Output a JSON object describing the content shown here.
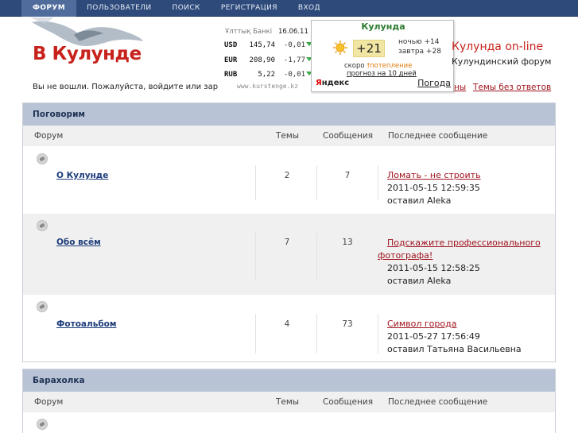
{
  "nav": {
    "items": [
      "ФОРУМ",
      "ПОЛЬЗОВАТЕЛИ",
      "ПОИСК",
      "РЕГИСТРАЦИЯ",
      "ВХОД"
    ],
    "active": 0
  },
  "logo": {
    "text": "В Кулунде"
  },
  "currency": {
    "title": "Ұлттық Банкі",
    "date": "16.06.11",
    "rows": [
      {
        "code": "USD",
        "value": "145,74",
        "change": "-0,01"
      },
      {
        "code": "EUR",
        "value": "208,90",
        "change": "-1,77"
      },
      {
        "code": "RUB",
        "value": "5,22",
        "change": "-0,01"
      }
    ],
    "source": "www.kurstenge.kz"
  },
  "weather": {
    "city": "Кулунда",
    "temp": "+21",
    "night": "ночью +14",
    "tomorrow": "завтра +28",
    "soon_prefix": "скоро",
    "soon_text": "потепление",
    "forecast_link": "прогноз на 10 дней",
    "provider_y": "Я",
    "provider_rest": "ндекс",
    "pogoda": "Погода"
  },
  "site": {
    "title": "Кулунда on-line",
    "description": "Кулундинский форум"
  },
  "login_message": "Вы не вошли. Пожалуйста, войдите или заре",
  "top_links": {
    "a": "ны",
    "b": "Темы без ответов"
  },
  "columns": {
    "forum": "Форум",
    "topics": "Темы",
    "posts": "Сообщения",
    "last": "Последнее сообщение"
  },
  "blocks": [
    {
      "title": "Поговорим",
      "rows": [
        {
          "name": "О Кулунде",
          "topics": "2",
          "posts": "7",
          "last_title_1": "Ломать - не строить",
          "last_title_2": "",
          "last_date": "2011-05-15 12:59:35",
          "last_by": "оставил Aleka"
        },
        {
          "name": "Обо всём",
          "topics": "7",
          "posts": "13",
          "last_title_1": "Подскажите профессионального",
          "last_title_2": "фотографа!",
          "last_date": "2011-05-15 12:58:25",
          "last_by": "оставил Aleka"
        },
        {
          "name": "Фотоальбом",
          "topics": "4",
          "posts": "73",
          "last_title_1": "Символ города",
          "last_title_2": "",
          "last_date": "2011-05-27 17:56:49",
          "last_by": "оставил Татьяна Васильевна"
        }
      ]
    },
    {
      "title": "Барахолка",
      "rows": []
    }
  ]
}
